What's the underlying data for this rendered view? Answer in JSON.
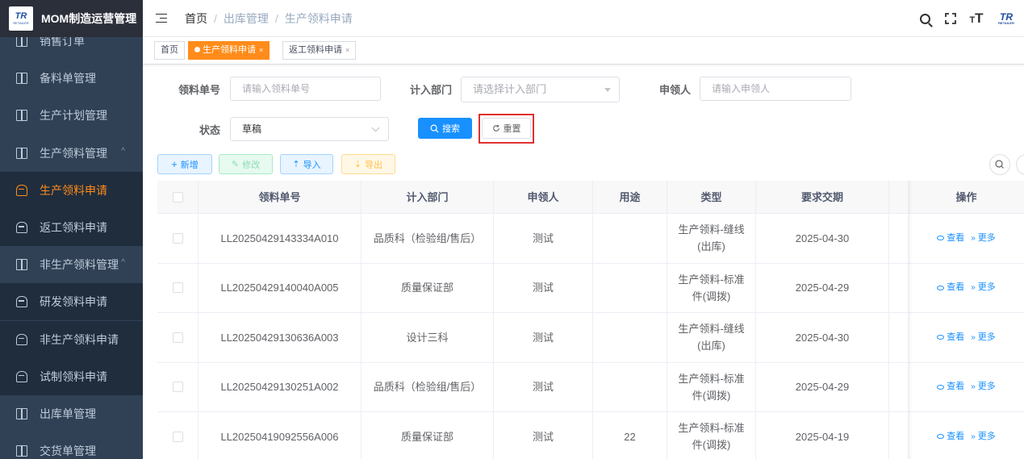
{
  "app": {
    "logo_text": "TR",
    "logo_sub": "RETAILER",
    "title": "MOM制造运营管理"
  },
  "sidebar": {
    "items": [
      {
        "label": "销售订单",
        "icon": "book-icon"
      },
      {
        "label": "备料单管理",
        "icon": "book-icon"
      },
      {
        "label": "生产计划管理",
        "icon": "book-icon"
      },
      {
        "label": "生产领料管理",
        "icon": "book-icon",
        "arrow": "^"
      },
      {
        "label": "生产领料申请",
        "icon": "cup-icon",
        "active": true
      },
      {
        "label": "返工领料申请",
        "icon": "cup-icon"
      },
      {
        "label": "非生产领料管理",
        "icon": "book-icon",
        "arrow": "^"
      },
      {
        "label": "研发领料申请",
        "icon": "cup-icon"
      },
      {
        "label": "非生产领料申请",
        "icon": "cup-icon"
      },
      {
        "label": "试制领料申请",
        "icon": "cup-icon"
      },
      {
        "label": "出库单管理",
        "icon": "book-icon"
      },
      {
        "label": "交货单管理",
        "icon": "book-icon"
      }
    ],
    "active_color": "#ff8c1a"
  },
  "header": {
    "breadcrumb": {
      "home": "首页",
      "level1": "出库管理",
      "level2": "生产领料申请",
      "separator": "/"
    },
    "icons": [
      "search-icon",
      "fullscreen-icon",
      "font-size-icon",
      "brand-logo"
    ],
    "font_icon_text": "T",
    "brand_text": "TR",
    "brand_sub": "RETAILER"
  },
  "tags": [
    {
      "label": "首页"
    },
    {
      "label": "生产领料申请",
      "active": true,
      "close": "×"
    },
    {
      "label": "返工领料申请",
      "close": "×"
    }
  ],
  "search_form": {
    "order_no": {
      "label": "领料单号",
      "placeholder": "请输入领料单号"
    },
    "department": {
      "label": "计入部门",
      "placeholder": "请选择计入部门"
    },
    "applicant": {
      "label": "申领人",
      "placeholder": "请输入申领人"
    },
    "status": {
      "label": "状态",
      "value": "草稿"
    },
    "search_button": "搜索",
    "reset_button": "重置"
  },
  "toolbar": {
    "add": "新增",
    "edit": "修改",
    "import": "导入",
    "export": "导出"
  },
  "table": {
    "columns": [
      "领料单号",
      "计入部门",
      "申领人",
      "用途",
      "类型",
      "要求交期",
      "操作"
    ],
    "rows": [
      {
        "order_no": "LL20250429143334A010",
        "department": "品质科（检验组/售后）",
        "applicant": "测试",
        "purpose": "",
        "type_l1": "生产领料-缝线",
        "type_l2": "(出库)",
        "due_date": "2025-04-30"
      },
      {
        "order_no": "LL20250429140040A005",
        "department": "质量保证部",
        "applicant": "测试",
        "purpose": "",
        "type_l1": "生产领料-标准",
        "type_l2": "件(调拨)",
        "due_date": "2025-04-29"
      },
      {
        "order_no": "LL20250429130636A003",
        "department": "设计三科",
        "applicant": "测试",
        "purpose": "",
        "type_l1": "生产领料-缝线",
        "type_l2": "(出库)",
        "due_date": "2025-04-30"
      },
      {
        "order_no": "LL20250429130251A002",
        "department": "品质科（检验组/售后）",
        "applicant": "测试",
        "purpose": "",
        "type_l1": "生产领料-标准",
        "type_l2": "件(调拨)",
        "due_date": "2025-04-29"
      },
      {
        "order_no": "LL20250419092556A006",
        "department": "质量保证部",
        "applicant": "测试",
        "purpose": "22",
        "type_l1": "生产领料-标准",
        "type_l2": "件(调拨)",
        "due_date": "2025-04-19"
      }
    ],
    "actions": {
      "view": "查看",
      "more": "更多",
      "more_icon": "»"
    }
  }
}
